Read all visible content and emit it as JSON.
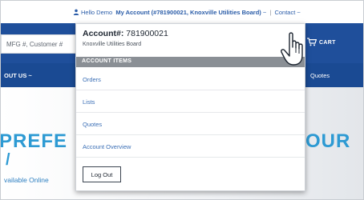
{
  "topbar": {
    "greeting": "Hello Demo",
    "account_link": "My Account (#781900021, Knoxville Utilities Board)",
    "account_caret": "~",
    "separator": "|",
    "contact": "Contact",
    "contact_caret": "~"
  },
  "search": {
    "placeholder": "MFG #, Customer #"
  },
  "header": {
    "cart_label": "CART"
  },
  "nav": {
    "about": "OUT US ~",
    "quotes": "Quotes"
  },
  "hero": {
    "headline_left": "PREFE",
    "headline_right": "OUR",
    "headline_second": "/",
    "available": "vailable Online"
  },
  "dropdown": {
    "account_label": "Account#:",
    "account_number": "781900021",
    "org_name": "Knoxville Utilities Board",
    "section_title": "ACCOUNT ITEMS",
    "items": [
      {
        "label": "Orders"
      },
      {
        "label": "Lists"
      },
      {
        "label": "Quotes"
      },
      {
        "label": "Account Overview"
      }
    ],
    "logout_label": "Log Out"
  },
  "colors": {
    "brand_blue": "#1f4f9b",
    "link_blue": "#3b6fb6",
    "hero_text": "#2d9ad3",
    "section_gray": "#8a8f95"
  },
  "icons": [
    "user-icon",
    "cart-icon",
    "hand-cursor-icon"
  ]
}
